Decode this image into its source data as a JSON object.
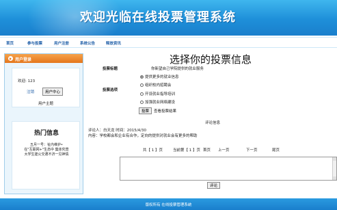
{
  "header": {
    "title": "欢迎光临在线投票管理系统"
  },
  "nav": {
    "items": [
      "首页",
      "参与投票",
      "用户注册",
      "系统公告",
      "释放资讯"
    ]
  },
  "sidebar": {
    "login_title": "用户登录",
    "welcome": "欢迎: 123",
    "logout": "注销",
    "center_button": "用户中心",
    "user_link": "用户主题",
    "hot_title": "热门信息",
    "hot_lines": [
      "五月一号：祉内维护•",
      "在\"互联网+\"生态中 集体究竟",
      "大学生建公交遭不济一见神情"
    ]
  },
  "main": {
    "page_title": "选择你的投票信息",
    "topic_label": "投票标题",
    "topic_value": "你新望自己学院提供的就业服务",
    "options_label": "投票选项",
    "options": [
      {
        "label": "提供更多的就业信息",
        "checked": true
      },
      {
        "label": "组织校内招聘会",
        "checked": false
      },
      {
        "label": "开设就业指导培训",
        "checked": false
      },
      {
        "label": "加强就业网络建设",
        "checked": false
      }
    ],
    "vote_button": "投票",
    "view_results": "查看投票结果",
    "comments_heading": "评论信息",
    "comment_meta": "评论人：白天龙 时间：2015/4/30",
    "comment_body": "内容：学校都会和企业有合作，定向的提供对就业会有更多的帮助",
    "pager": {
      "total": "共【 1 】页",
      "current": "当前第【 1 】页",
      "first": "首页",
      "prev": "上一页",
      "next": "下一页",
      "last": "尾页"
    },
    "submit_button": "评论"
  },
  "footer": {
    "text": "版权所有 在线投票管理系统"
  },
  "colors": {
    "banner": "#1e8fd9",
    "nav_text": "#1f5fa8",
    "login_header": "#e4761c",
    "sidebar_bg": "#eaf5fc",
    "footer": "#1a7fcc"
  }
}
